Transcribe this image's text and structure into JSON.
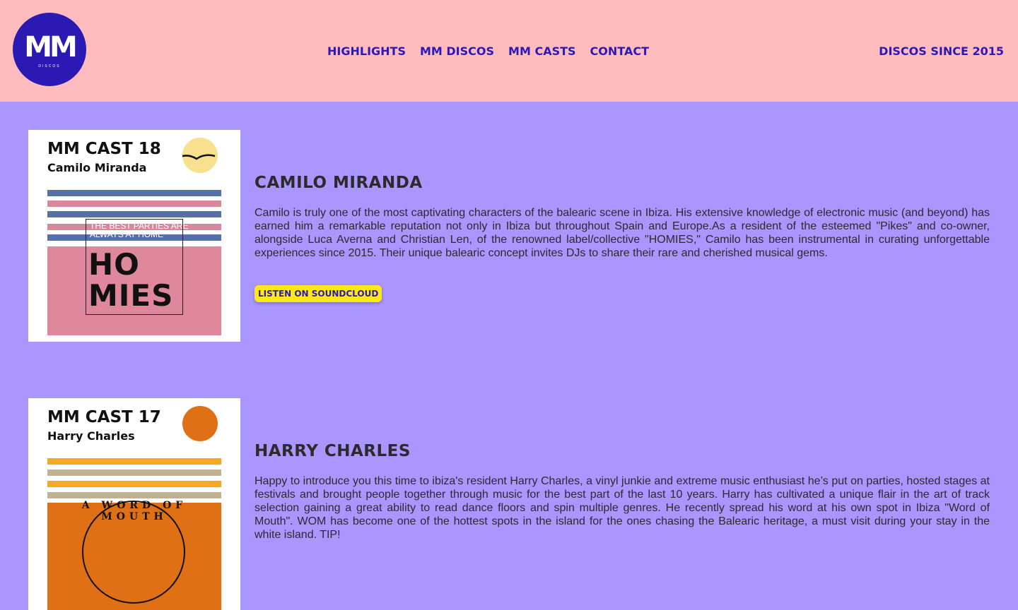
{
  "header": {
    "logo_text": "MM",
    "logo_sub": "DISCOS",
    "nav": [
      "HIGHLIGHTS",
      "MM DISCOS",
      "MM CASTS",
      "CONTACT"
    ],
    "tagline": "DISCOS SINCE 2015"
  },
  "casts": [
    {
      "cover_title": "MM CAST 18",
      "cover_artist": "Camilo Miranda",
      "cover_small_text": "THE BEST PARTIES ARE ALWAYS AT HOME",
      "cover_big_text": "HO MIES",
      "name": "CAMILO MIRANDA",
      "bio": "Camilo is truly one of the most captivating characters of the balearic scene in Ibiza. His extensive knowledge of electronic music (and beyond) has earned him a remarkable reputation not only in Ibiza but throughout Spain and Europe.As a resident of the esteemed \"Pikes\" and co-owner, alongside Luca Averna and Christian Len, of the renowned label/collective \"HOMIES,\" Camilo has been instrumental in curating unforgettable experiences since 2015. Their unique balearic concept invites DJs to share their rare and cherished musical gems.",
      "button": "LISTEN ON SOUNDCLOUD"
    },
    {
      "cover_title": "MM CAST 17",
      "cover_artist": "Harry Charles",
      "cover_ring_text": "A WORD OF MOUTH",
      "name": "HARRY CHARLES",
      "bio": "Happy to introduce you this time to ibiza's resident Harry Charles, a vinyl junkie and extreme music enthusiast he’s put on parties, hosted stages at festivals and brought people together through music for the best part of the last 10 years. Harry has cultivated a unique flair in the art of track selection gaining a great ability to read dance floors and spin multiple genres. He recently spread his word at his own spot in Ibiza \"Word of Mouth\". WOM has become one of the hottest spots in the island for the ones chasing the Balearic heritage, a must visit during your stay in the white island. TIP!"
    }
  ],
  "colors": {
    "header_bg": "#ffbcbf",
    "page_bg": "#a996ff",
    "brand_blue": "#2b19b4",
    "button_yellow": "#ffe818"
  }
}
